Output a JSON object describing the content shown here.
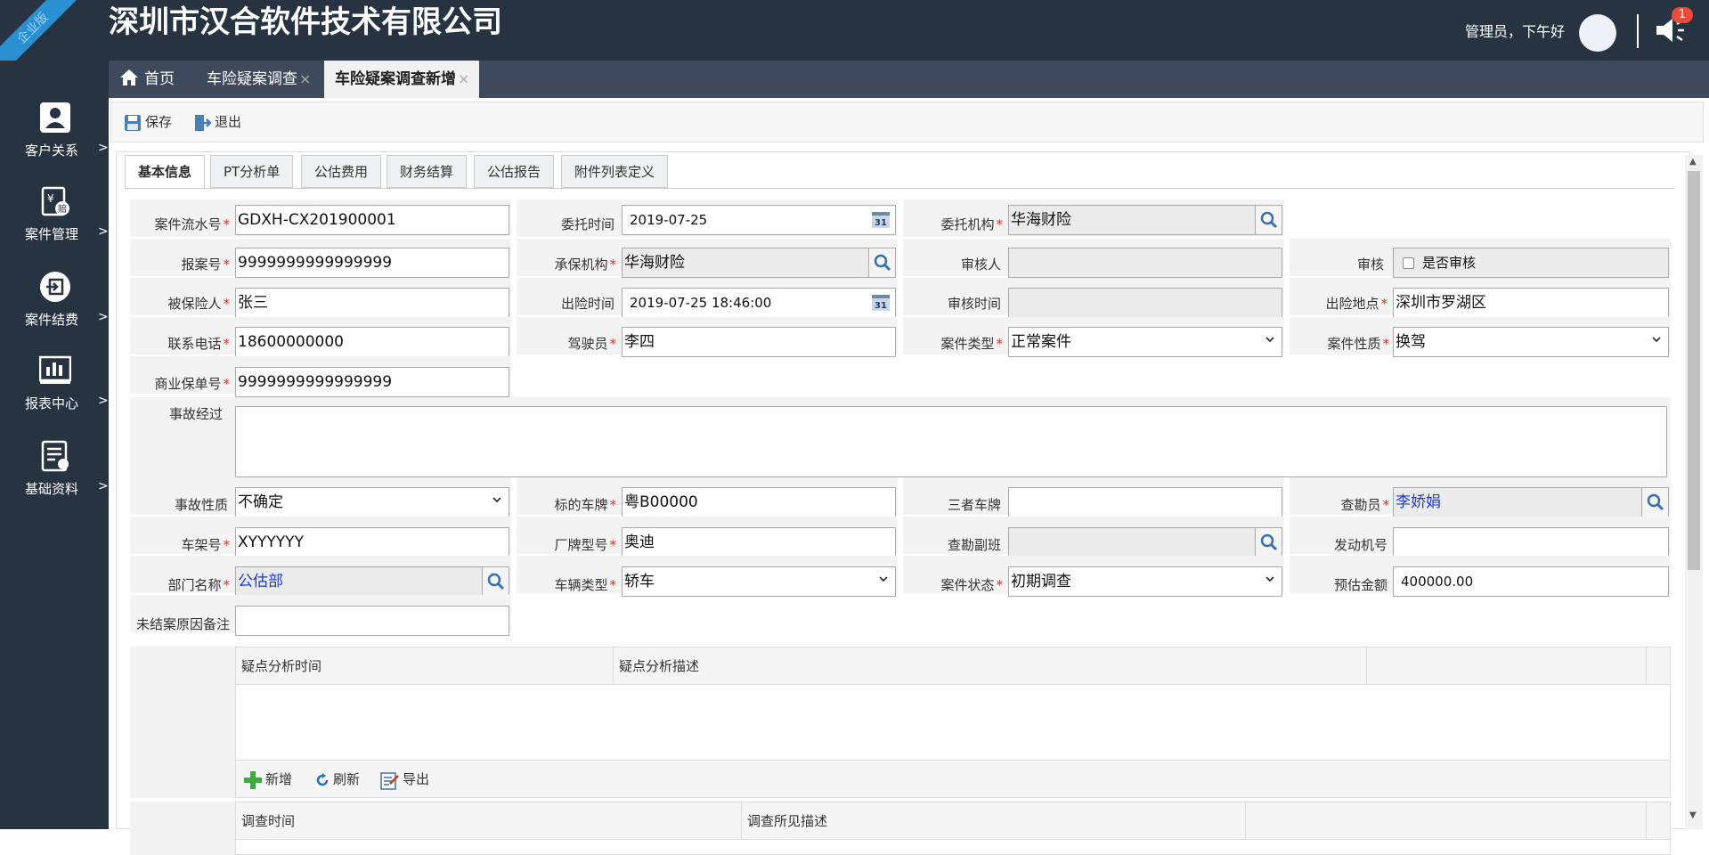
{
  "header": {
    "edition_ribbon": "企业版",
    "company_name": "深圳市汉合软件技术有限公司",
    "greeting": "管理员，下午好",
    "notification_count": "1"
  },
  "sidebar": {
    "items": [
      {
        "label": "客户关系",
        "arrow": ">"
      },
      {
        "label": "案件管理",
        "arrow": ">"
      },
      {
        "label": "案件结费",
        "arrow": ">"
      },
      {
        "label": "报表中心",
        "arrow": ">"
      },
      {
        "label": "基础资料",
        "arrow": ">"
      }
    ]
  },
  "tabs": [
    {
      "label": "首页"
    },
    {
      "label": "车险疑案调查",
      "close": "×"
    },
    {
      "label": "车险疑案调查新增",
      "close": "×"
    }
  ],
  "toolbar": {
    "save": "保存",
    "exit": "退出"
  },
  "subtabs": [
    "基本信息",
    "PT分析单",
    "公估费用",
    "财务结算",
    "公估报告",
    "附件列表定义"
  ],
  "form": {
    "case_no": {
      "label": "案件流水号",
      "value": "GDXH-CX201900001"
    },
    "entrust_time": {
      "label": "委托时间",
      "value": "2019-07-25"
    },
    "entrust_org": {
      "label": "委托机构",
      "value": "华海财险"
    },
    "report_no": {
      "label": "报案号",
      "value": "9999999999999999"
    },
    "insurer": {
      "label": "承保机构",
      "value": "华海财险"
    },
    "reviewer": {
      "label": "审核人",
      "value": ""
    },
    "review": {
      "label": "审核",
      "checkbox": "是否审核"
    },
    "insured": {
      "label": "被保险人",
      "value": "张三"
    },
    "accident_time": {
      "label": "出险时间",
      "value": "2019-07-25 18:46:00"
    },
    "review_time": {
      "label": "审核时间",
      "value": ""
    },
    "accident_place": {
      "label": "出险地点",
      "value": "深圳市罗湖区"
    },
    "phone": {
      "label": "联系电话",
      "value": "18600000000"
    },
    "driver": {
      "label": "驾驶员",
      "value": "李四"
    },
    "case_type": {
      "label": "案件类型",
      "value": "正常案件"
    },
    "case_nature": {
      "label": "案件性质",
      "value": "换驾"
    },
    "commercial_policy": {
      "label": "商业保单号",
      "value": "9999999999999999"
    },
    "accident_desc": {
      "label": "事故经过",
      "value": ""
    },
    "accident_nature": {
      "label": "事故性质",
      "value": "不确定"
    },
    "target_plate": {
      "label": "标的车牌",
      "value": "粤B00000"
    },
    "third_plate": {
      "label": "三者车牌",
      "value": ""
    },
    "surveyor": {
      "label": "查勘员",
      "value": "李娇娟"
    },
    "vin": {
      "label": "车架号",
      "value": "XYYYYYY"
    },
    "model": {
      "label": "厂牌型号",
      "value": "奥迪"
    },
    "survey_shift": {
      "label": "查勘副班",
      "value": ""
    },
    "engine_no": {
      "label": "发动机号",
      "value": ""
    },
    "dept": {
      "label": "部门名称",
      "value": "公估部"
    },
    "vehicle_type": {
      "label": "车辆类型",
      "value": "轿车"
    },
    "case_status": {
      "label": "案件状态",
      "value": "初期调查"
    },
    "estimate": {
      "label": "预估金额",
      "value": "400000.00"
    },
    "pending_note": {
      "label": "未结案原因备注",
      "value": ""
    }
  },
  "grid1": {
    "columns": [
      "疑点分析时间",
      "疑点分析描述"
    ],
    "tools": {
      "add": "新增",
      "refresh": "刷新",
      "export": "导出"
    }
  },
  "grid2": {
    "columns": [
      "调查时间",
      "调查所见描述"
    ]
  },
  "colors": {
    "dark": "#283342",
    "tabbar": "#3d4a5c",
    "ribbon": "#2a8fd1",
    "required": "#e03030",
    "badge": "#e74c3c"
  }
}
